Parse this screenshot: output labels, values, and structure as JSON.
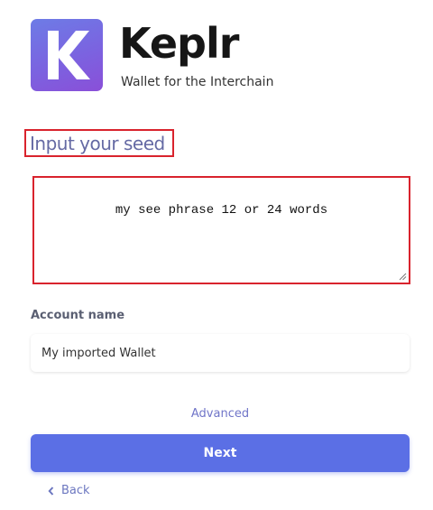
{
  "brand": {
    "logo_letter": "K",
    "name": "Keplr",
    "tagline": "Wallet for the Interchain"
  },
  "seed_section": {
    "title": "Input your seed",
    "value": "my see phrase 12 or 24 words"
  },
  "account": {
    "label": "Account name",
    "value": "My imported Wallet"
  },
  "advanced_label": "Advanced",
  "next_label": "Next",
  "back_label": "Back",
  "colors": {
    "primary": "#5b6fe5",
    "highlight_border": "#d9232d",
    "title": "#656aa4",
    "link": "#7075c8"
  },
  "icons": {
    "back": "chevron-left-icon",
    "resize": "resize-handle-icon"
  }
}
